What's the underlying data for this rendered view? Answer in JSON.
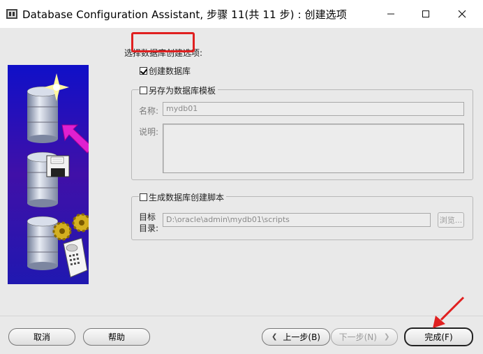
{
  "window": {
    "title": "Database Configuration Assistant, 步骤 11(共 11 步) : 创建选项",
    "minimize_glyph": "—",
    "maximize_glyph": "☐",
    "close_glyph": "✕"
  },
  "form": {
    "prompt": "选择数据库创建选项:",
    "create_db_label": "创建数据库",
    "create_db_checked": true,
    "template_group": {
      "label": "另存为数据库模板",
      "checked": false,
      "name_label": "名称:",
      "name_value": "mydb01",
      "desc_label": "说明:"
    },
    "script_group": {
      "label": "生成数据库创建脚本",
      "checked": false,
      "dest_label_line1": "目标",
      "dest_label_line2": "目录:",
      "dest_value": "D:\\oracle\\admin\\mydb01\\scripts",
      "browse_label": "浏览..."
    }
  },
  "buttons": {
    "cancel": "取消",
    "help": "帮助",
    "back": "上一步(B)",
    "next": "下一步(N)",
    "finish": "完成(F)"
  },
  "colors": {
    "highlight": "#e02020",
    "dialog_bg": "#e9e9e9"
  }
}
